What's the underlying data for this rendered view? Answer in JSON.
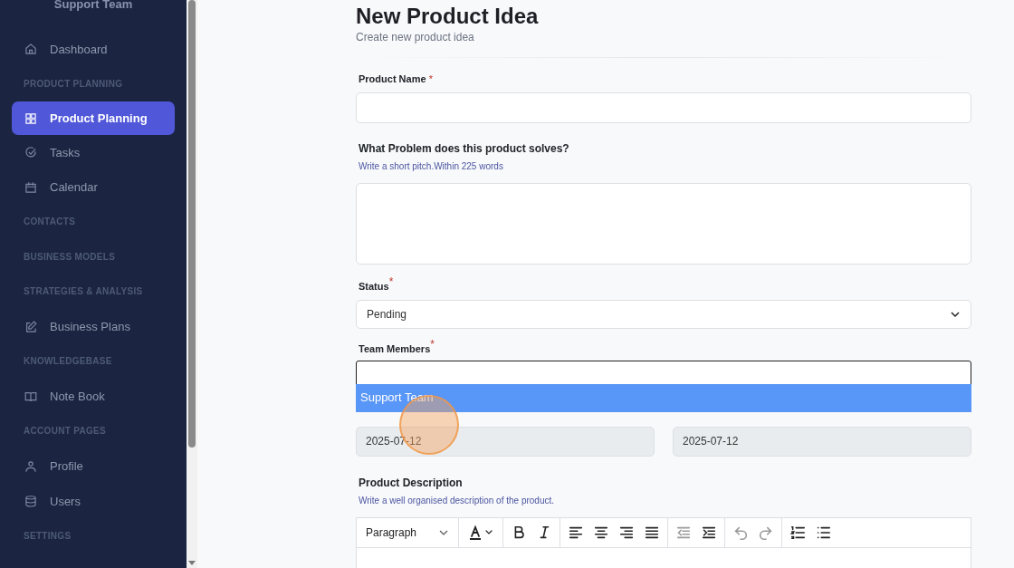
{
  "sidebar": {
    "team": "Support Team",
    "items": [
      {
        "kind": "link",
        "label": "Dashboard",
        "selected": false
      },
      {
        "kind": "heading",
        "label": "PRODUCT PLANNING"
      },
      {
        "kind": "link",
        "label": "Product Planning",
        "selected": true
      },
      {
        "kind": "link",
        "label": "Tasks",
        "selected": false
      },
      {
        "kind": "link",
        "label": "Calendar",
        "selected": false
      },
      {
        "kind": "heading",
        "label": "CONTACTS"
      },
      {
        "kind": "heading",
        "label": "BUSINESS MODELS"
      },
      {
        "kind": "heading",
        "label": "STRATEGIES & ANALYSIS"
      },
      {
        "kind": "link",
        "label": "Business Plans",
        "selected": false
      },
      {
        "kind": "heading",
        "label": "KNOWLEDGEBASE"
      },
      {
        "kind": "link",
        "label": "Note Book",
        "selected": false
      },
      {
        "kind": "heading",
        "label": "ACCOUNT PAGES"
      },
      {
        "kind": "link",
        "label": "Profile",
        "selected": false
      },
      {
        "kind": "link",
        "label": "Users",
        "selected": false
      },
      {
        "kind": "heading",
        "label": "SETTINGS"
      }
    ]
  },
  "page": {
    "title": "New Product Idea",
    "subtitle": "Create new product idea"
  },
  "form": {
    "product_name": {
      "label": "Product Name",
      "required_mark": "*"
    },
    "problem": {
      "label": "What Problem does this product solves?",
      "hint": "Write a short pitch.Within 225 words"
    },
    "status": {
      "label": "Status",
      "required_mark": "*",
      "value": "Pending"
    },
    "team_members": {
      "label": "Team Members",
      "required_mark": "*",
      "options": [
        {
          "label": "Support Team",
          "selected": true
        }
      ]
    },
    "start_date": {
      "value": "2025-07-12"
    },
    "end_date": {
      "value": "2025-07-12"
    },
    "description": {
      "label": "Product Description",
      "hint": "Write a well organised description of the product.",
      "block_format": "Paragraph",
      "tools": [
        {
          "kind": "font-color",
          "disabled": false
        },
        {
          "kind": "bold",
          "disabled": false
        },
        {
          "kind": "italic",
          "disabled": false
        },
        {
          "kind": "align-left",
          "disabled": false
        },
        {
          "kind": "align-center",
          "disabled": false
        },
        {
          "kind": "align-right",
          "disabled": false
        },
        {
          "kind": "align-justify",
          "disabled": false
        },
        {
          "kind": "outdent",
          "disabled": true
        },
        {
          "kind": "indent",
          "disabled": false
        },
        {
          "kind": "undo",
          "disabled": true
        },
        {
          "kind": "redo",
          "disabled": true
        },
        {
          "kind": "numbered-list",
          "disabled": false
        },
        {
          "kind": "bulleted-list",
          "disabled": false
        }
      ]
    }
  }
}
